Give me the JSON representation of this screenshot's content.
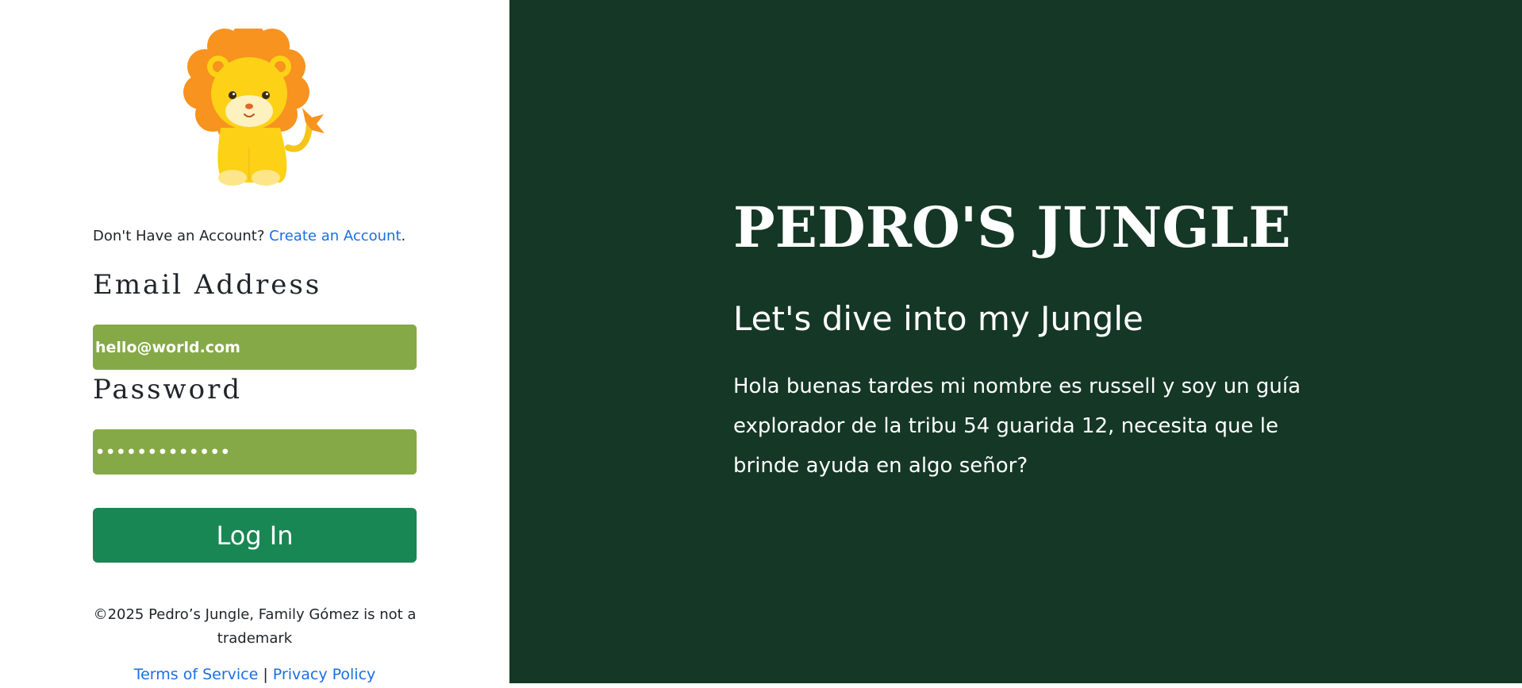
{
  "login_panel": {
    "signup_prompt": "Don't Have an Account?",
    "signup_link": "Create an Account",
    "signup_period": ".",
    "email_label": "Email Address",
    "email_value": "hello@world.com",
    "password_label": "Password",
    "password_value": "•••••••••••••",
    "login_button": "Log In",
    "copyright": "©2025 Pedro’s Jungle, Family Gómez is not a trademark",
    "terms_link": "Terms of Service",
    "separator": "|",
    "privacy_link": "Privacy Policy",
    "logo_icon": "lion-mascot-icon"
  },
  "hero": {
    "title": "PEDRO'S JUNGLE",
    "subtitle": "Let's dive into my Jungle",
    "body": "Hola buenas tardes mi nombre es russell y soy un guía explorador de la tribu 54 guarida 12, necesita que le brinde ayuda en algo señor?"
  },
  "colors": {
    "hero_background": "#153726",
    "field_background": "#86a947",
    "button_background": "#198754",
    "link": "#1a6fe0"
  }
}
